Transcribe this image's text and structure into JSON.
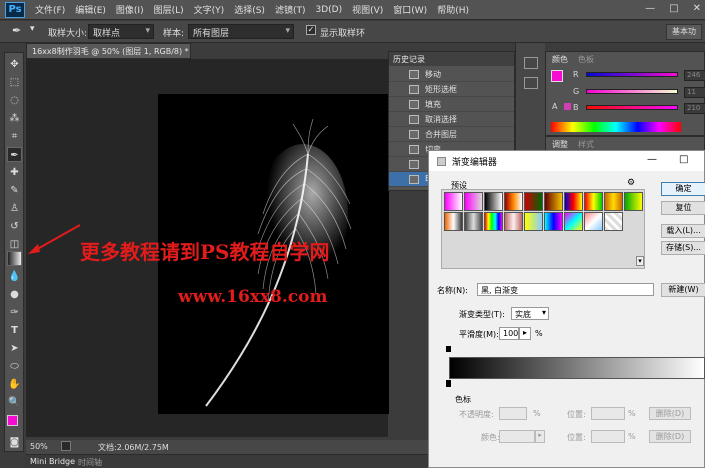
{
  "menubar": {
    "logo": "Ps",
    "items": [
      "文件(F)",
      "编辑(E)",
      "图像(I)",
      "图层(L)",
      "文字(Y)",
      "选择(S)",
      "滤镜(T)",
      "3D(D)",
      "视图(V)",
      "窗口(W)",
      "帮助(H)"
    ],
    "minimize": "—",
    "restore": "□",
    "close": "✕"
  },
  "options": {
    "sample_size_label": "取样大小:",
    "sample_size_value": "取样点",
    "sample_label": "样本:",
    "sample_value": "所有图层",
    "show_ring_label": "显示取样环",
    "show_ring_checked": true,
    "workspace": "基本功"
  },
  "document": {
    "tab_title": "16xx8制作羽毛 @ 50% (图层 1, RGB/8) *",
    "tab_close": "×",
    "zoom": "50%",
    "doc_info": "文档:2.06M/2.75M",
    "bottom_tabs": [
      "Mini Bridge",
      "时间轴"
    ]
  },
  "watermark": {
    "line1": "更多教程请到PS教程自学网",
    "line2": "www.16xx8.com"
  },
  "history": {
    "title": "历史记录",
    "items": [
      "移动",
      "矩形选框",
      "填充",
      "取消选择",
      "合并图层",
      "切变",
      "",
      "E"
    ]
  },
  "color_panel": {
    "tabs": [
      "颜色",
      "色板"
    ],
    "channels": [
      {
        "name": "R",
        "value": "246"
      },
      {
        "name": "G",
        "value": "11"
      },
      {
        "name": "B",
        "value": "210"
      }
    ],
    "fg_color": "#f60bd2",
    "adj_tabs": [
      "调整",
      "样式"
    ]
  },
  "dialog": {
    "title": "渐变编辑器",
    "minimize": "—",
    "maximize": "□",
    "presets_label": "预设",
    "buttons": {
      "ok": "确定",
      "reset": "复位",
      "load": "载入(L)...",
      "save": "存储(S)...",
      "new": "新建(W)"
    },
    "name_label": "名称(N):",
    "name_value": "黑, 白渐变",
    "type_label": "渐变类型(T):",
    "type_value": "实底",
    "smooth_label": "平滑度(M):",
    "smooth_value": "100",
    "smooth_unit": "%",
    "stops_label": "色标",
    "opacity_label": "不透明度:",
    "location_label": "位置:",
    "color_label": "颜色:",
    "pct": "%",
    "delete_label": "删除(D)",
    "gradient_start": "#000000",
    "gradient_end": "#ffffff"
  }
}
